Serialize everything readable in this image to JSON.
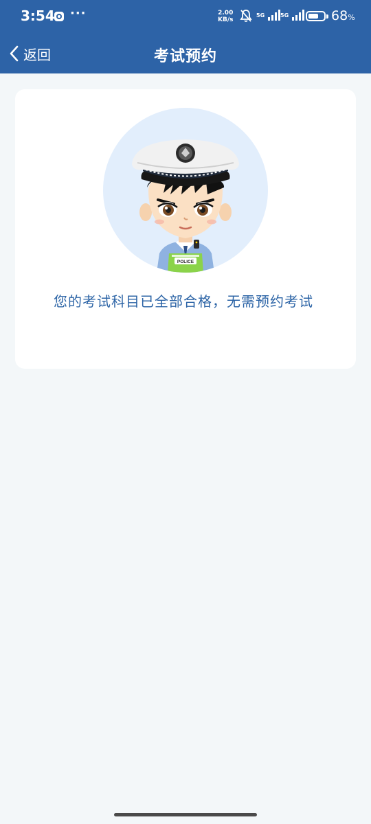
{
  "status_bar": {
    "time": "3:54",
    "app_icon": "browser-app-icon",
    "more": "···",
    "net_speed_value": "2.00",
    "net_speed_unit": "KB/s",
    "bell_icon": "bell-muted-icon",
    "signal1_label": "5G",
    "signal2_label": "5G",
    "battery_percent": "68",
    "battery_unit": "%",
    "battery_level": 0.68
  },
  "nav": {
    "back_label": "返回",
    "title": "考试预约"
  },
  "card": {
    "illustration": "police-officer-avatar",
    "badge_text": "POLICE",
    "message": "您的考试科目已全部合格，无需预约考试"
  },
  "colors": {
    "primary": "#2d63a7",
    "page_bg": "#f3f7f9",
    "card_bg": "#ffffff",
    "message_text": "#2c64a6",
    "avatar_circle": "#e2eefc"
  }
}
